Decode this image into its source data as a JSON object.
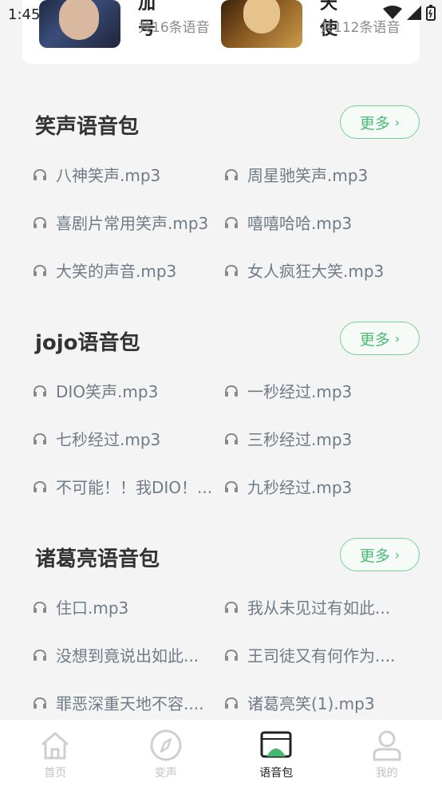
{
  "status": {
    "time": "1:45"
  },
  "top_card": {
    "items": [
      {
        "title": "加号",
        "count": "共16条语音"
      },
      {
        "title": "天使",
        "count": "共112条语音"
      }
    ]
  },
  "sections": [
    {
      "title": "笑声语音包",
      "more": "更多",
      "items": [
        "八神笑声.mp3",
        "周星驰笑声.mp3",
        "喜剧片常用笑声.mp3",
        "嘻嘻哈哈.mp3",
        "大笑的声音.mp3",
        "女人疯狂大笑.mp3"
      ]
    },
    {
      "title": "jojo语音包",
      "more": "更多",
      "items": [
        "DIO笑声.mp3",
        "一秒经过.mp3",
        "七秒经过.mp3",
        "三秒经过.mp3",
        "不可能！！我DIO！...",
        "九秒经过.mp3"
      ]
    },
    {
      "title": "诸葛亮语音包",
      "more": "更多",
      "items": [
        "住口.mp3",
        "我从未见过有如此...",
        "没想到竟说出如此...",
        "王司徒又有何作为....",
        "罪恶深重天地不容....",
        "诸葛亮笑(1).mp3"
      ]
    }
  ],
  "nav": {
    "items": [
      {
        "label": "首页",
        "icon": "home-icon"
      },
      {
        "label": "变声",
        "icon": "compass-icon"
      },
      {
        "label": "语音包",
        "icon": "voice-pack-icon",
        "active": true
      },
      {
        "label": "我的",
        "icon": "user-icon"
      }
    ]
  },
  "colors": {
    "accent": "#4cbc77",
    "item_text": "#6f7b87",
    "inactive_nav": "#c4c4c4"
  }
}
